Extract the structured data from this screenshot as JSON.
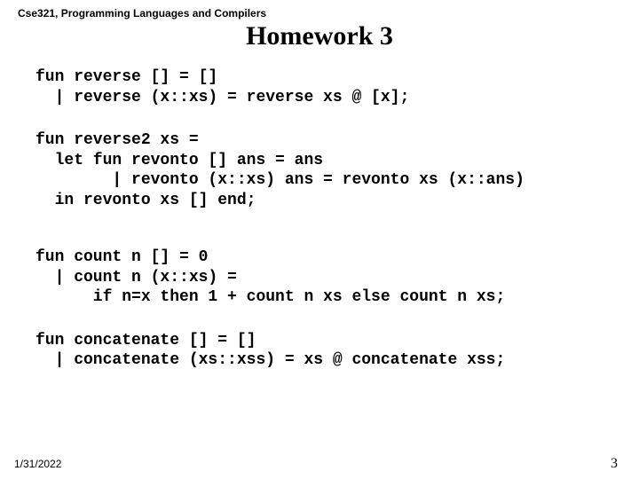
{
  "header": {
    "course": "Cse321, Programming Languages and Compilers"
  },
  "title": "Homework 3",
  "code": {
    "block1": "fun reverse [] = []\n  | reverse (x::xs) = reverse xs @ [x];",
    "block2": "fun reverse2 xs =\n  let fun revonto [] ans = ans\n        | revonto (x::xs) ans = revonto xs (x::ans)\n  in revonto xs [] end;",
    "block3": "fun count n [] = 0\n  | count n (x::xs) =\n      if n=x then 1 + count n xs else count n xs;",
    "block4": "fun concatenate [] = []\n  | concatenate (xs::xss) = xs @ concatenate xss;"
  },
  "footer": {
    "date": "1/31/2022",
    "page": "3"
  }
}
